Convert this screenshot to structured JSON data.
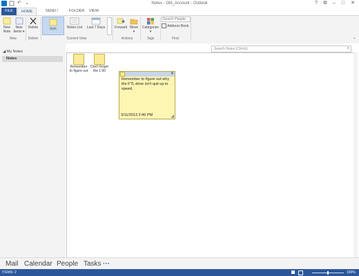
{
  "window": {
    "title": "Notes - Old_Account - Outlook"
  },
  "qat": {
    "undo": "↶",
    "dropdown": "⌄"
  },
  "window_controls": {
    "help": "?",
    "restore": "⧉",
    "minimize": "–",
    "maximize": "□",
    "close": "✕"
  },
  "tabs": [
    "FILE",
    "HOME",
    "SEND / RECEIVE",
    "FOLDER",
    "VIEW"
  ],
  "ribbon": {
    "new_note": "New Note",
    "new_items": "New Items",
    "new_items_arrow": "▾",
    "delete": "Delete",
    "icon_view": "Icon",
    "notes_list": "Notes List",
    "last_7_days": "Last 7 Days",
    "forward": "Forward",
    "move": "Move",
    "move_arrow": "▾",
    "categorize": "Categorize",
    "categorize_arrow": "▾",
    "search_people_placeholder": "Search People",
    "address_book": "Address Book",
    "groups": {
      "new": "New",
      "delete": "Delete",
      "current_view": "Current View",
      "actions": "Actions",
      "tags": "Tags",
      "find": "Find"
    }
  },
  "folder_pane": {
    "my_notes": "◢ My Notes",
    "notes": "Notes"
  },
  "search": {
    "placeholder": "Search Notes (Ctrl+E)"
  },
  "notes": [
    {
      "label_line1": "Remember",
      "label_line2": "to figure out"
    },
    {
      "label_line1": "Don't forget",
      "label_line2": "the 1:00"
    }
  ],
  "open_note": {
    "body": "Remember to figure out why the FTL drive isn't quit up to speed.",
    "date": "3/11/2013 2:46 PM"
  },
  "nav": {
    "mail": "Mail",
    "calendar": "Calendar",
    "people": "People",
    "tasks": "Tasks",
    "more": "···"
  },
  "status": {
    "items": "ITEMS: 2",
    "zoom": "100%"
  },
  "colors": {
    "accent": "#2b579a",
    "note_yellow": "#fdf6b3"
  }
}
